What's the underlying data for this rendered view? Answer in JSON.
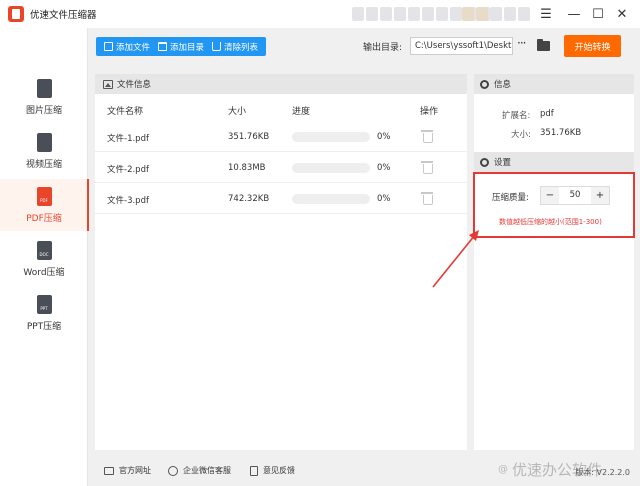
{
  "app": {
    "title": "优速文件压缩器"
  },
  "window": {
    "menu": "☰",
    "minimize": "—",
    "maximize": "☐",
    "close": "✕"
  },
  "sidebar": {
    "items": [
      {
        "label": "图片压缩",
        "tag": "",
        "active": false
      },
      {
        "label": "视频压缩",
        "tag": "",
        "active": false
      },
      {
        "label": "PDF压缩",
        "tag": "PDF",
        "active": true
      },
      {
        "label": "Word压缩",
        "tag": "DOC",
        "active": false
      },
      {
        "label": "PPT压缩",
        "tag": "PPT",
        "active": false
      }
    ]
  },
  "toolbar": {
    "add_file": "添加文件",
    "add_folder": "添加目录",
    "clear_list": "清除列表",
    "output_label": "输出目录:",
    "output_path": "C:\\Users\\yssoft1\\Deskt",
    "more": "···",
    "start": "开始转换"
  },
  "file_panel": {
    "title": "文件信息",
    "columns": {
      "name": "文件名称",
      "size": "大小",
      "progress": "进度",
      "action": "操作"
    },
    "rows": [
      {
        "name": "文件-1.pdf",
        "size": "351.76KB",
        "progress_text": "0%",
        "progress": 0
      },
      {
        "name": "文件-2.pdf",
        "size": "10.83MB",
        "progress_text": "0%",
        "progress": 0
      },
      {
        "name": "文件-3.pdf",
        "size": "742.32KB",
        "progress_text": "0%",
        "progress": 0
      }
    ]
  },
  "info_panel": {
    "title": "信息",
    "ext_label": "扩展名:",
    "ext_value": "pdf",
    "size_label": "大小:",
    "size_value": "351.76KB"
  },
  "settings_panel": {
    "title": "设置",
    "quality_label": "压缩质量:",
    "quality_value": "50",
    "minus": "−",
    "plus": "+",
    "hint": "数值越低压缩的越小(范围1-300)"
  },
  "footer": {
    "website": "官方网址",
    "wechat": "企业微信客服",
    "feedback": "意见反馈",
    "watermark": "优速办公软件",
    "version": "版本: V2.2.2.0"
  },
  "colors": {
    "accent": "#e8452b",
    "primary": "#2196f3",
    "start": "#ff6a00",
    "annotation": "#e53935"
  }
}
